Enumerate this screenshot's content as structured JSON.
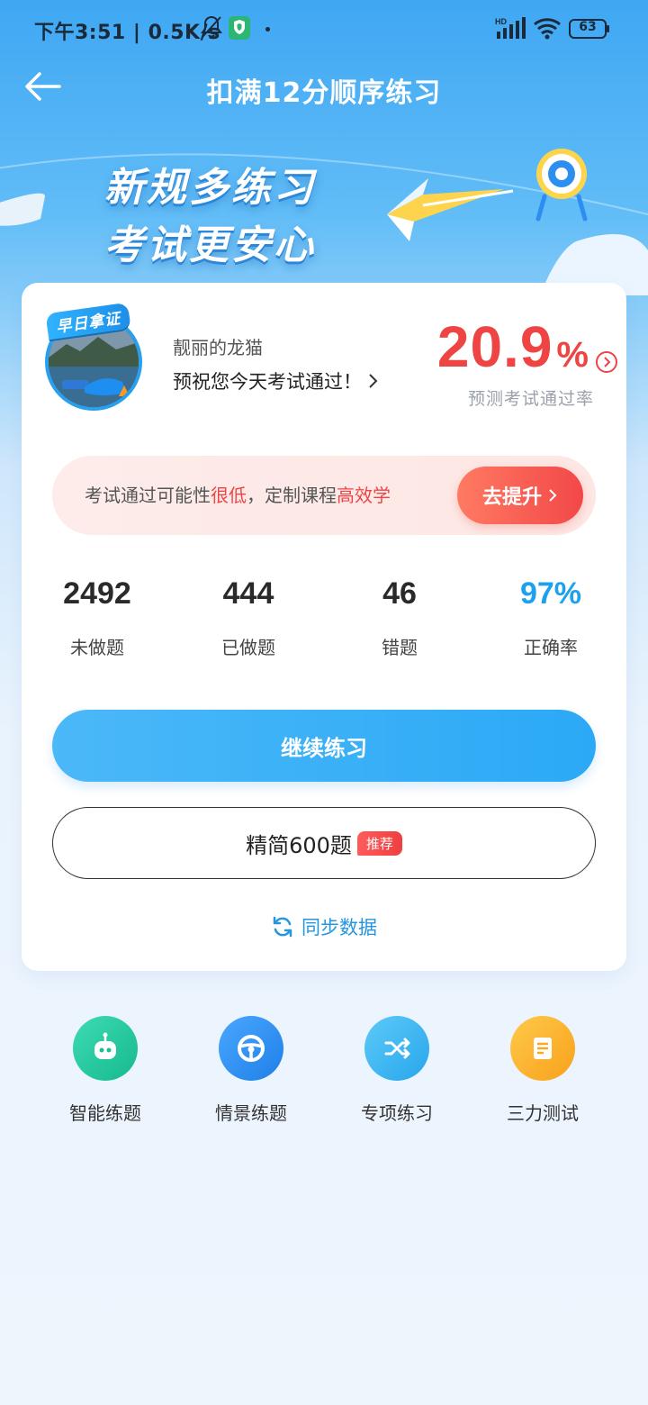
{
  "status_bar": {
    "time_speed": "下午3:51 | 0.5K/s",
    "network": "HD",
    "battery": "63"
  },
  "header": {
    "title": "扣满12分顺序练习"
  },
  "banner": {
    "line1": "新规多练习",
    "line2": "考试更安心"
  },
  "profile": {
    "badge": "早日拿证",
    "name": "靓丽的龙猫",
    "wish": "预祝您今天考试通过！"
  },
  "pass_rate": {
    "value": "20.9",
    "unit": "%",
    "label": "预测考试通过率"
  },
  "notice": {
    "text_a": "考试通过可能性",
    "text_hl1": "很低",
    "text_b": "，定制课程",
    "text_hl2": "高效学",
    "button": "去提升"
  },
  "stats": [
    {
      "value": "2492",
      "label": "未做题"
    },
    {
      "value": "444",
      "label": "已做题"
    },
    {
      "value": "46",
      "label": "错题"
    },
    {
      "value": "97%",
      "label": "正确率"
    }
  ],
  "actions": {
    "continue": "继续练习",
    "simplified": "精简600题",
    "recommend_tag": "推荐",
    "sync": "同步数据"
  },
  "tools": [
    {
      "label": "智能练题",
      "icon": "robot-icon"
    },
    {
      "label": "情景练题",
      "icon": "steering-wheel-icon"
    },
    {
      "label": "专项练习",
      "icon": "shuffle-icon"
    },
    {
      "label": "三力测试",
      "icon": "document-icon"
    }
  ],
  "colors": {
    "accent_blue": "#2ba9f6",
    "accent_red": "#ef4444",
    "tool_green": "#22c6a0",
    "tool_blue": "#2c8ff0",
    "tool_cyan": "#3ab8f2",
    "tool_orange": "#fdb62f"
  }
}
